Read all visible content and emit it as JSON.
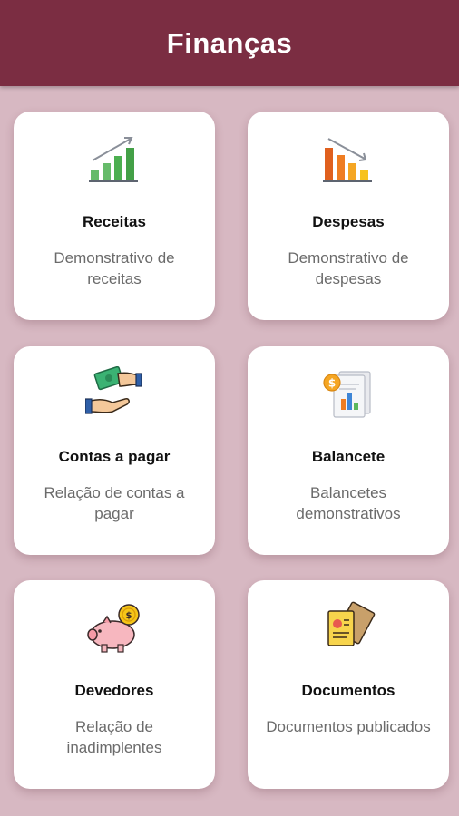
{
  "header": {
    "title": "Finanças"
  },
  "colors": {
    "header_bg": "#7b2d42",
    "page_bg": "#d7b8c2",
    "card_bg": "#ffffff"
  },
  "cards": [
    {
      "title": "Receitas",
      "description": "Demonstrativo de receitas",
      "icon": "growth-chart-icon"
    },
    {
      "title": "Despesas",
      "description": "Demonstrativo de despesas",
      "icon": "decline-chart-icon"
    },
    {
      "title": "Contas a pagar",
      "description": "Relação de contas a pagar",
      "icon": "money-hands-icon"
    },
    {
      "title": "Balancete",
      "description": "Balancetes demonstrativos",
      "icon": "report-document-icon"
    },
    {
      "title": "Devedores",
      "description": "Relação de inadimplentes",
      "icon": "piggy-bank-icon"
    },
    {
      "title": "Documentos",
      "description": "Documentos publicados",
      "icon": "documents-icon"
    }
  ]
}
